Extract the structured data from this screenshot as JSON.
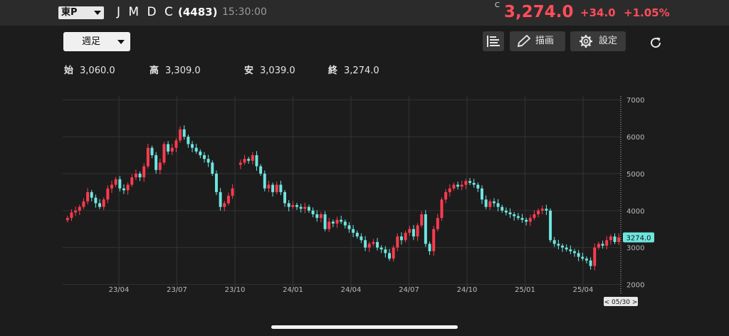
{
  "header": {
    "exchange": "東P",
    "company_name": "J M D C",
    "code": "(4483)",
    "time": "15:30:00",
    "close_mark": "C",
    "price": "3,274.0",
    "change": "+34.0",
    "change_pct": "+1.05%"
  },
  "toolbar": {
    "period": "週足",
    "draw_label": "描画",
    "settings_label": "設定"
  },
  "ohlc": {
    "open_label": "始",
    "open": "3,060.0",
    "high_label": "高",
    "high": "3,309.0",
    "low_label": "安",
    "low": "3,039.0",
    "close_label": "終",
    "close": "3,274.0"
  },
  "colors": {
    "up": "#ff3b4e",
    "down": "#6ee6e0",
    "accent": "#ff4d5a",
    "background": "#1c1c1c"
  },
  "chart_data": {
    "type": "candlestick",
    "y_ticks": [
      2000,
      3000,
      4000,
      5000,
      6000,
      7000
    ],
    "y_tick_labels": [
      "2000",
      "3000",
      "4000",
      "5000",
      "6000",
      "7000"
    ],
    "ylim": [
      1800,
      7100
    ],
    "x_tick_labels": [
      "23/04",
      "23/07",
      "23/10",
      "24/01",
      "24/04",
      "24/07",
      "24/10",
      "25/01",
      "25/04"
    ],
    "last_price_label": "3274.0",
    "cursor_label": "< 05/30 >",
    "grid": true,
    "closes": [
      3800,
      3950,
      4000,
      4100,
      4250,
      4500,
      4350,
      4200,
      4100,
      4300,
      4600,
      4700,
      4850,
      4600,
      4550,
      4700,
      4900,
      5000,
      4900,
      5200,
      5700,
      5500,
      5100,
      5300,
      5800,
      5600,
      5700,
      5900,
      6200,
      6000,
      5800,
      5700,
      5600,
      5500,
      5400,
      5300,
      5000,
      4500,
      4100,
      4200,
      4400,
      4600,
      null,
      5300,
      5400,
      5350,
      5500,
      5200,
      5000,
      4600,
      4700,
      4500,
      4700,
      4500,
      4200,
      4100,
      4150,
      4100,
      4050,
      4100,
      4000,
      3900,
      3800,
      3900,
      3500,
      3700,
      3650,
      3750,
      3700,
      3600,
      3500,
      3400,
      3300,
      3200,
      3000,
      3100,
      3150,
      3000,
      2950,
      2850,
      2700,
      3000,
      3300,
      3200,
      3400,
      3500,
      3300,
      3600,
      3900,
      3100,
      2900,
      3500,
      3800,
      4300,
      4500,
      4600,
      4700,
      4650,
      4700,
      4800,
      4750,
      4700,
      4600,
      4300,
      4100,
      4250,
      4200,
      4100,
      4000,
      3950,
      3900,
      3850,
      3800,
      3750,
      3700,
      3800,
      3900,
      4000,
      4050,
      4000,
      3200,
      3100,
      3050,
      3000,
      2950,
      2900,
      2850,
      2750,
      2700,
      2650,
      2500,
      3000,
      3100,
      3050,
      3200,
      3300,
      3150,
      3274
    ]
  }
}
